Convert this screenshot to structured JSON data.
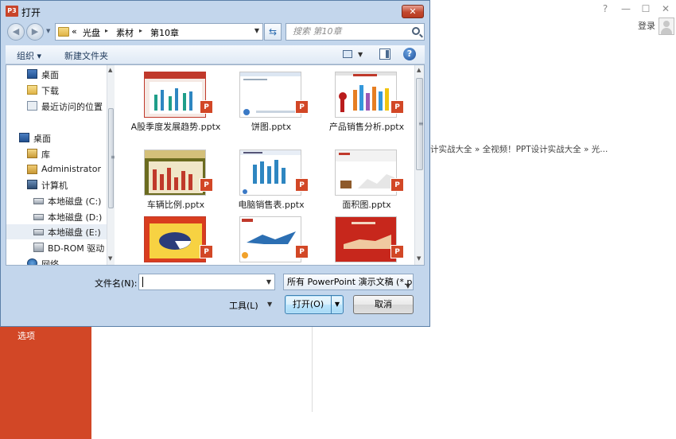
{
  "background": {
    "options_label": "选项",
    "window_controls": [
      "?",
      "—",
      "☐",
      "✕"
    ],
    "login_label": "登录",
    "recent_path": "计实战大全 » 全视频！PPT设计实战大全 » 光..."
  },
  "dialog": {
    "app_icon_label": "P3",
    "title": "打开",
    "close_label": "✕",
    "address": {
      "prefix": "«",
      "segments": [
        "光盘",
        "素材",
        "第10章"
      ],
      "separator": "▸"
    },
    "refresh_label": "⇆",
    "search_placeholder": "搜索 第10章",
    "toolbar": {
      "organize_label": "组织 ▾",
      "new_folder_label": "新建文件夹"
    },
    "nav_items": [
      {
        "label": "桌面",
        "icon": "desktop-icon"
      },
      {
        "label": "下载",
        "icon": "download-folder-icon"
      },
      {
        "label": "最近访问的位置",
        "icon": "recent-places-icon"
      },
      {
        "label": "桌面",
        "icon": "desktop-icon"
      },
      {
        "label": "库",
        "icon": "library-icon"
      },
      {
        "label": "Administrator",
        "icon": "user-folder-icon"
      },
      {
        "label": "计算机",
        "icon": "computer-icon"
      },
      {
        "label": "本地磁盘 (C:)",
        "icon": "system-drive-icon"
      },
      {
        "label": "本地磁盘 (D:)",
        "icon": "drive-icon"
      },
      {
        "label": "本地磁盘 (E:)",
        "icon": "drive-icon",
        "selected": true
      },
      {
        "label": "BD-ROM 驱动",
        "icon": "cd-drive-icon"
      },
      {
        "label": "网络",
        "icon": "network-icon"
      }
    ],
    "files": [
      {
        "name": "A股季度发展趋势.pptx",
        "badge": "P"
      },
      {
        "name": "饼图.pptx",
        "badge": "P"
      },
      {
        "name": "产品销售分析.pptx",
        "badge": "P"
      },
      {
        "name": "车辆比例.pptx",
        "badge": "P"
      },
      {
        "name": "电脑销售表.pptx",
        "badge": "P"
      },
      {
        "name": "面积图.pptx",
        "badge": "P"
      },
      {
        "name": "",
        "badge": "P"
      },
      {
        "name": "",
        "badge": "P"
      },
      {
        "name": "",
        "badge": "P"
      }
    ],
    "filename_label": "文件名(N):",
    "filename_value": "",
    "filetype_value": "所有 PowerPoint 演示文稿 (*.p",
    "tools_label": "工具(L)",
    "open_label": "打开(O)",
    "cancel_label": "取消"
  },
  "colors": {
    "accent": "#d24726",
    "dialog_frame": "#c3d6ec",
    "close_button": "#c2492f"
  }
}
